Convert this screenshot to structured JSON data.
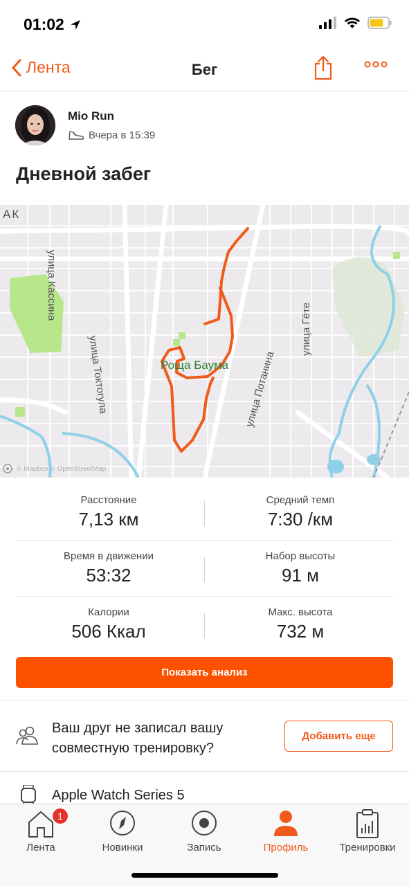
{
  "status": {
    "time": "01:02"
  },
  "nav": {
    "back_label": "Лента",
    "title": "Бег"
  },
  "athlete": {
    "name": "Mio Run",
    "time": "Вчера в 15:39"
  },
  "activity": {
    "title": "Дневной забег"
  },
  "map": {
    "labels": {
      "kasina": "улица Кассина",
      "toktogula": "улица Токтогула",
      "gete": "улица Гёте",
      "potanina": "улица Потанина",
      "park": "Роща Баума",
      "corner": "АК"
    },
    "attribution": "© Mapbox © OpenStreetMap"
  },
  "stats": [
    {
      "left": {
        "label": "Расстояние",
        "value": "7,13 км"
      },
      "right": {
        "label": "Средний темп",
        "value": "7:30 /км"
      }
    },
    {
      "left": {
        "label": "Время в движении",
        "value": "53:32"
      },
      "right": {
        "label": "Набор высоты",
        "value": "91 м"
      }
    },
    {
      "left": {
        "label": "Калории",
        "value": "506 Ккал"
      },
      "right": {
        "label": "Макс. высота",
        "value": "732 м"
      }
    }
  ],
  "analysis_button": "Показать анализ",
  "friend": {
    "text": "Ваш друг не записал вашу совместную тренировку?",
    "button": "Добавить еще"
  },
  "device": {
    "label": "Apple Watch Series 5"
  },
  "tabs": [
    {
      "label": "Лента",
      "icon": "home-icon",
      "badge": "1"
    },
    {
      "label": "Новинки",
      "icon": "compass-icon"
    },
    {
      "label": "Запись",
      "icon": "record-icon"
    },
    {
      "label": "Профиль",
      "icon": "profile-icon"
    },
    {
      "label": "Тренировки",
      "icon": "clipboard-chart-icon"
    }
  ],
  "colors": {
    "accent": "#fc5200",
    "route": "#f05a1a",
    "park": "#b8e68a"
  }
}
